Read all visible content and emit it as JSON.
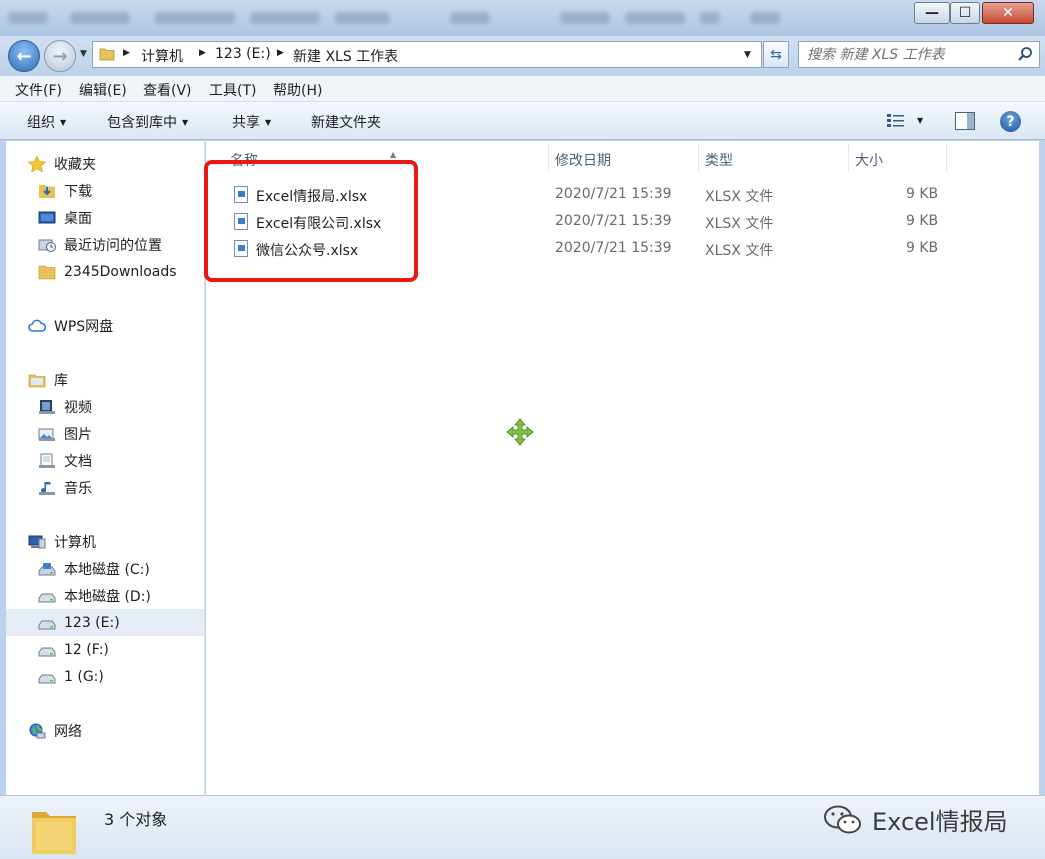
{
  "titlebar": {
    "minimize_glyph": "—",
    "maximize_glyph": "☐",
    "close_glyph": "✕"
  },
  "address": {
    "crumbs": [
      "计算机",
      "123 (E:)",
      "新建 XLS 工作表"
    ],
    "search_placeholder": "搜索 新建 XLS 工作表"
  },
  "menu": [
    "文件(F)",
    "编辑(E)",
    "查看(V)",
    "工具(T)",
    "帮助(H)"
  ],
  "toolbar": {
    "organize": "组织",
    "include_in_library": "包含到库中",
    "share": "共享",
    "new_folder": "新建文件夹"
  },
  "sidebar": {
    "favorites": {
      "label": "收藏夹",
      "items": [
        "下载",
        "桌面",
        "最近访问的位置",
        "2345Downloads"
      ]
    },
    "wps": "WPS网盘",
    "libraries": {
      "label": "库",
      "items": [
        "视频",
        "图片",
        "文档",
        "音乐"
      ]
    },
    "computer": {
      "label": "计算机",
      "items": [
        "本地磁盘 (C:)",
        "本地磁盘 (D:)",
        "123 (E:)",
        "12 (F:)",
        "1 (G:)"
      ],
      "selected": "123 (E:)"
    },
    "network": "网络"
  },
  "columns": [
    "名称",
    "修改日期",
    "类型",
    "大小"
  ],
  "files": [
    {
      "name": "Excel情报局.xlsx",
      "modified": "2020/7/21 15:39",
      "type": "XLSX 文件",
      "size": "9 KB"
    },
    {
      "name": "Excel有限公司.xlsx",
      "modified": "2020/7/21 15:39",
      "type": "XLSX 文件",
      "size": "9 KB"
    },
    {
      "name": "微信公众号.xlsx",
      "modified": "2020/7/21 15:39",
      "type": "XLSX 文件",
      "size": "9 KB"
    }
  ],
  "status": {
    "count": "3 个对象"
  },
  "watermark": "Excel情报局",
  "colors": {
    "highlight": "#ee1515",
    "move_cursor": "#7cc43a"
  }
}
